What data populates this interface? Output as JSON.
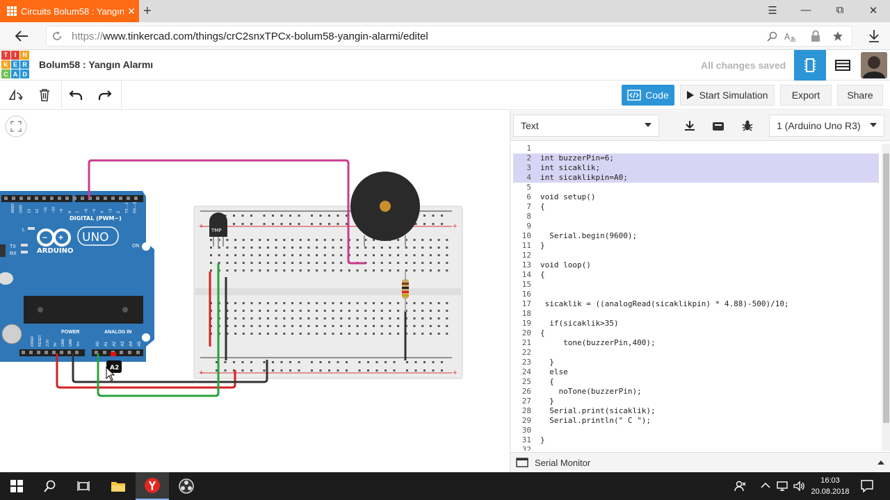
{
  "browser": {
    "tab_title": "Circuits Bolum58 : Yangın",
    "new_tab_symbol": "+",
    "url_scheme": "https://",
    "url_rest": "www.tinkercad.com/things/crC2snxTPCx-bolum58-yangin-alarmi/editel",
    "controls": {
      "menu": "☰",
      "minimize": "—",
      "restore": "⧉",
      "close": "✕"
    }
  },
  "app": {
    "logo_letters": [
      "T",
      "I",
      "N",
      "K",
      "E",
      "R",
      "C",
      "A",
      "D"
    ],
    "logo_colors": [
      "#e2403a",
      "#e2403a",
      "#f6a21b",
      "#f6a21b",
      "#2b95d6",
      "#2b95d6",
      "#71c052",
      "#2b95d6",
      "#2b95d6"
    ],
    "title": "Bolum58 : Yangın Alarmı",
    "status": "All changes saved",
    "accent": "#2b95d6"
  },
  "toolbar": {
    "code_label": "Code",
    "start_label": "Start Simulation",
    "export_label": "Export",
    "share_label": "Share"
  },
  "circuit": {
    "arduino_digital": "DIGITAL (PWM~)",
    "arduino_brand": "ARDUINO",
    "arduino_model": "UNO",
    "arduino_on": "ON",
    "arduino_tx": "TX",
    "arduino_rx": "RX",
    "arduino_l": "L",
    "arduino_power": "POWER",
    "arduino_analog": "ANALOG IN",
    "analog_pins": [
      "A0",
      "A1",
      "A2",
      "A3",
      "A4",
      "A5"
    ],
    "power_pins": [
      "IOREF",
      "RESET",
      "3.3V",
      "5V",
      "GND",
      "GND",
      "Vin"
    ],
    "digital_pins": [
      "AREF",
      "GND",
      "13",
      "12",
      "~11",
      "~10",
      "~9",
      "8",
      "7",
      "~6",
      "~5",
      "4",
      "~3",
      "2",
      "TX→1",
      "RX←0"
    ],
    "sensor_label": "TMP",
    "tooltip": "A2",
    "board_color": "#2f77b7"
  },
  "code_panel": {
    "mode": "Text",
    "device": "1 (Arduino Uno R3)",
    "serial_monitor": "Serial Monitor",
    "lines": [
      {
        "n": "1",
        "t": ""
      },
      {
        "n": "2",
        "t": "int buzzerPin=6;"
      },
      {
        "n": "3",
        "t": "int sicaklik;"
      },
      {
        "n": "4",
        "t": "int sicaklikpin=A0;"
      },
      {
        "n": "5",
        "t": ""
      },
      {
        "n": "6",
        "t": "void setup()"
      },
      {
        "n": "7",
        "t": "{"
      },
      {
        "n": "8",
        "t": ""
      },
      {
        "n": "9",
        "t": ""
      },
      {
        "n": "10",
        "t": "  Serial.begin(9600);"
      },
      {
        "n": "11",
        "t": "}"
      },
      {
        "n": "12",
        "t": ""
      },
      {
        "n": "13",
        "t": "void loop()"
      },
      {
        "n": "14",
        "t": "{"
      },
      {
        "n": "15",
        "t": ""
      },
      {
        "n": "16",
        "t": ""
      },
      {
        "n": "17",
        "t": " sicaklik = ((analogRead(sicaklikpin) * 4.88)-500)/10;"
      },
      {
        "n": "18",
        "t": ""
      },
      {
        "n": "19",
        "t": "  if(sicaklik>35)"
      },
      {
        "n": "20",
        "t": "{"
      },
      {
        "n": "21",
        "t": "     tone(buzzerPin,400);"
      },
      {
        "n": "22",
        "t": ""
      },
      {
        "n": "23",
        "t": "  }"
      },
      {
        "n": "24",
        "t": "  else"
      },
      {
        "n": "25",
        "t": "  {"
      },
      {
        "n": "26",
        "t": "    noTone(buzzerPin);"
      },
      {
        "n": "27",
        "t": "  }"
      },
      {
        "n": "28",
        "t": "  Serial.print(sicaklik);"
      },
      {
        "n": "29",
        "t": "  Serial.println(\" C \");"
      },
      {
        "n": "30",
        "t": ""
      },
      {
        "n": "31",
        "t": "}"
      },
      {
        "n": "32",
        "t": ""
      }
    ],
    "highlighted_lines": [
      "2",
      "3",
      "4"
    ]
  },
  "taskbar": {
    "time": "16:03",
    "date": "20.08.2018"
  }
}
